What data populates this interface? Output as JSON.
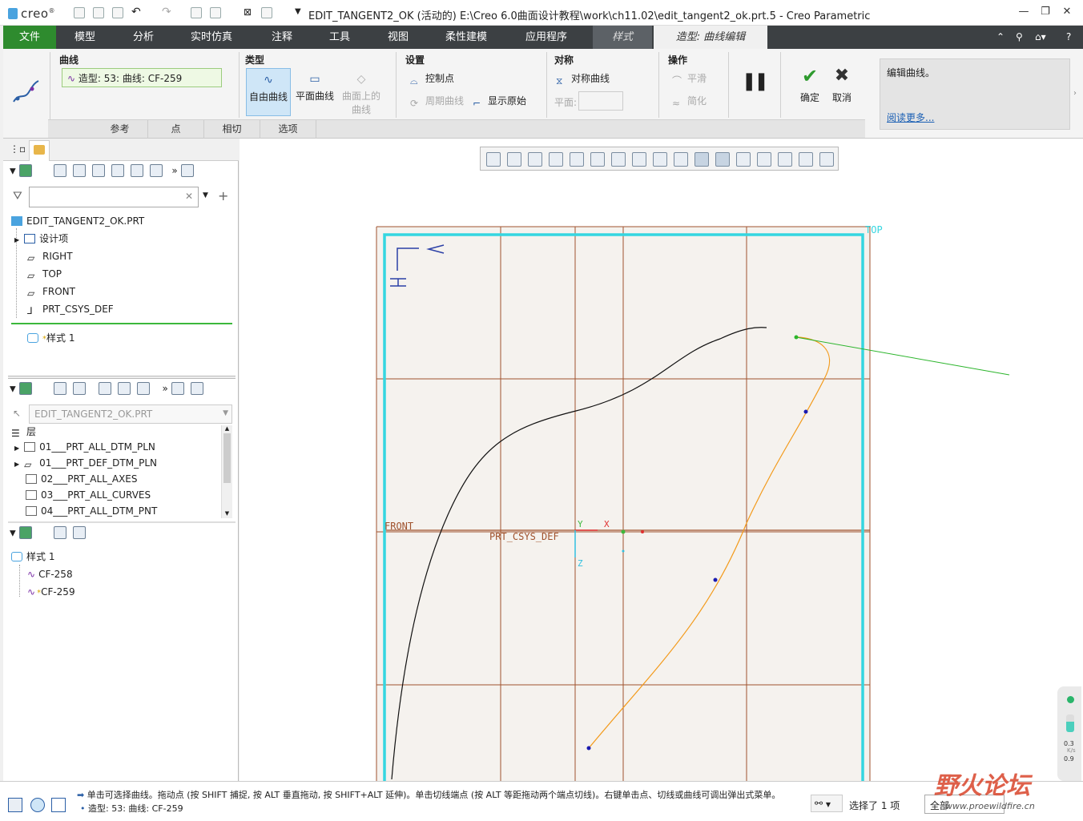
{
  "window": {
    "logo": "creo",
    "title": "EDIT_TANGENT2_OK (活动的) E:\\Creo 6.0曲面设计教程\\work\\ch11.02\\edit_tangent2_ok.prt.5 - Creo Parametric",
    "min": "—",
    "max": "❐",
    "close": "✕"
  },
  "menubar": {
    "file": "文件",
    "items": [
      "模型",
      "分析",
      "实时仿真",
      "注释",
      "工具",
      "视图",
      "柔性建模",
      "应用程序"
    ],
    "style_tab": "样式",
    "curve_edit_tab": "造型: 曲线编辑"
  },
  "ribbon": {
    "curve_group": {
      "title": "曲线",
      "value": "造型: 53: 曲线: CF-259"
    },
    "type_group": {
      "title": "类型",
      "free": "自由曲线",
      "planar": "平面曲线",
      "on_surface_line1": "曲面上的",
      "on_surface_line2": "曲线"
    },
    "settings_group": {
      "title": "设置",
      "control_points": "控制点",
      "periodic": "周期曲线",
      "show_original": "显示原始"
    },
    "symmetry_group": {
      "title": "对称",
      "symmetric_curve": "对称曲线",
      "plane_label": "平面:"
    },
    "operations_group": {
      "title": "操作",
      "smooth": "平滑",
      "simplify": "简化"
    },
    "pause": "❚❚",
    "ok_label": "确定",
    "cancel_label": "取消",
    "ok_icon": "✔",
    "cancel_icon": "✖",
    "help_text": "编辑曲线。",
    "help_link": "阅读更多...",
    "sub_tabs": [
      "参考",
      "点",
      "相切",
      "选项"
    ]
  },
  "model_tree": {
    "search_placeholder": "",
    "root": "EDIT_TANGENT2_OK.PRT",
    "items": [
      "设计项",
      "RIGHT",
      "TOP",
      "FRONT",
      "PRT_CSYS_DEF"
    ],
    "insert_item": "样式 1"
  },
  "layer_tree": {
    "model_select": "EDIT_TANGENT2_OK.PRT",
    "header": "层",
    "items": [
      "01___PRT_ALL_DTM_PLN",
      "01___PRT_DEF_DTM_PLN",
      "02___PRT_ALL_AXES",
      "03___PRT_ALL_CURVES",
      "04___PRT_ALL_DTM_PNT"
    ]
  },
  "style_tree": {
    "root": "样式 1",
    "items": [
      "CF-258",
      "CF-259"
    ]
  },
  "canvas": {
    "plane_top": "TOP",
    "plane_front": "FRONT",
    "csys": "PRT_CSYS_DEF",
    "axis_x": "X",
    "axis_y": "Y",
    "axis_z": "Z",
    "colors": {
      "frame": "#35d6e0",
      "grid": "#a0522d",
      "curve_orange": "#f39a1a",
      "tangent_line": "#2cb52c",
      "background": "#f5f2ee"
    }
  },
  "statusbar": {
    "message1": "单击可选择曲线。拖动点 (按 SHIFT 捕捉, 按 ALT 垂直拖动, 按 SHIFT+ALT 延伸)。单击切线端点 (按 ALT 等距拖动两个端点切线)。右键单击点、切线或曲线可调出弹出式菜单。",
    "message2": "造型: 53: 曲线: CF-259",
    "selected": "选择了 1 项",
    "filter": "全部",
    "watermark_cn": "野火论坛",
    "watermark_url": "www.proewildfire.cn",
    "net_up": "0.3",
    "net_down": "0.9",
    "net_unit": "K/s"
  }
}
